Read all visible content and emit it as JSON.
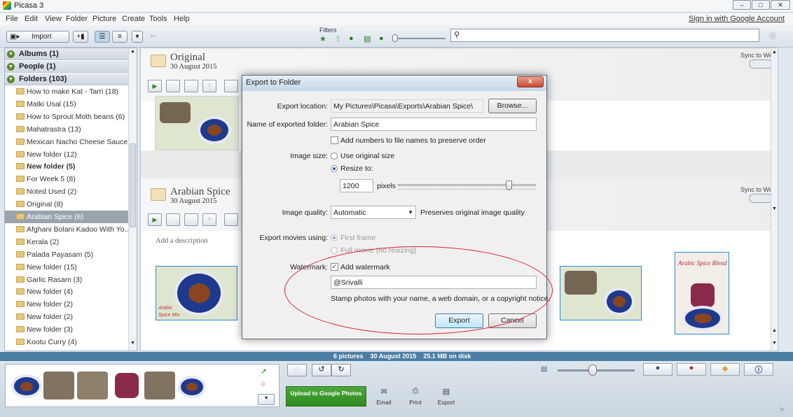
{
  "window": {
    "title": "Picasa 3"
  },
  "menu": {
    "items": [
      "File",
      "Edit",
      "View",
      "Folder",
      "Picture",
      "Create",
      "Tools",
      "Help"
    ],
    "signin": "Sign in with Google Account"
  },
  "toolbar": {
    "import_label": "Import",
    "filters_label": "Filters"
  },
  "sidebar": {
    "sections": [
      {
        "label": "Albums (1)"
      },
      {
        "label": "People (1)"
      },
      {
        "label": "Folders (103)"
      }
    ],
    "folders": [
      {
        "label": "How to make Kat - Tarri (18)",
        "style": "normal"
      },
      {
        "label": "Matki Usal (15)",
        "style": "normal"
      },
      {
        "label": "How to Sprout Moth beans (6)",
        "style": "normal"
      },
      {
        "label": "Mahatrastra (13)",
        "style": "normal"
      },
      {
        "label": "Mexican Nacho Cheese Sauce...",
        "style": "normal"
      },
      {
        "label": "New folder (12)",
        "style": "normal"
      },
      {
        "label": "New folder (5)",
        "style": "bold"
      },
      {
        "label": "For Week 5 (8)",
        "style": "normal"
      },
      {
        "label": "Noted Used (2)",
        "style": "normal"
      },
      {
        "label": "Original (8)",
        "style": "normal"
      },
      {
        "label": "Arabian Spice (6)",
        "style": "selected"
      },
      {
        "label": "Afghani Bolani Kadoo With Yo...",
        "style": "normal"
      },
      {
        "label": "Kerala (2)",
        "style": "normal"
      },
      {
        "label": "Palada Payasam (5)",
        "style": "normal"
      },
      {
        "label": "New folder (15)",
        "style": "normal"
      },
      {
        "label": "Garlic Rasam (3)",
        "style": "normal"
      },
      {
        "label": "New folder (4)",
        "style": "normal"
      },
      {
        "label": "New folder (2)",
        "style": "normal"
      },
      {
        "label": "New folder (2)",
        "style": "normal"
      },
      {
        "label": "New folder (3)",
        "style": "normal"
      },
      {
        "label": "Kootu Curry (4)",
        "style": "normal"
      }
    ]
  },
  "albums": {
    "original": {
      "title": "Original",
      "date": "30 August 2015",
      "sync": "Sync to Web"
    },
    "arabian": {
      "title": "Arabian Spice",
      "date": "30 August 2015",
      "sync": "Sync to Web",
      "description_placeholder": "Add a description"
    },
    "thumb_caption_a": "Arabic",
    "thumb_caption_b": "Spice Mix",
    "last_thumb_title": "Arabic Spice Blend"
  },
  "dialog": {
    "title": "Export to Folder",
    "close_label": "x",
    "location_label": "Export location:",
    "location_value": "My Pictures\\Picasa\\Exports\\Arabian Spice\\",
    "browse_label": "Browse...",
    "folder_name_label": "Name of exported folder:",
    "folder_name_value": "Arabian Spice",
    "add_numbers_label": "Add numbers to file names to preserve order",
    "image_size_label": "Image size:",
    "use_original_label": "Use original size",
    "resize_label": "Resize to:",
    "pixels_value": "1200",
    "pixels_label": "pixels",
    "slider_fraction": 0.82,
    "quality_label": "Image quality:",
    "quality_value": "Automatic",
    "quality_hint": "Preserves original image quality",
    "movies_label": "Export movies using:",
    "first_frame_label": "First frame",
    "full_movie_label": "Full movie (no resizing)",
    "watermark_label": "Watermark:",
    "add_watermark_label": "Add watermark",
    "watermark_value": "@Srivalli",
    "watermark_hint": "Stamp photos with your name, a web domain, or a copyright notice.",
    "export_label": "Export",
    "cancel_label": "Cancel"
  },
  "status": {
    "text": "6 pictures    30 August 2015    25.1 MB on disk"
  },
  "bottom": {
    "upload_label": "Upload to Google Photos",
    "email_label": "Email",
    "print_label": "Print",
    "export_label": "Export"
  },
  "colors": {
    "accent": "#4b7ea4",
    "upload_green": "#3a9a2b",
    "annotation_red": "#d8212a"
  }
}
